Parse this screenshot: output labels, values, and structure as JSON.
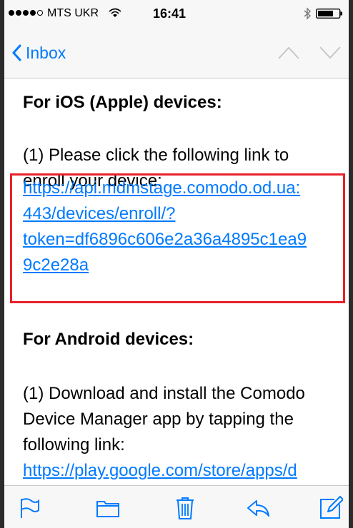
{
  "status_bar": {
    "carrier": "MTS UKR",
    "time": "16:41"
  },
  "nav": {
    "back_label": "Inbox"
  },
  "email": {
    "ios_heading": "For iOS (Apple) devices:",
    "ios_step_line1": "(1) Please click the following link to",
    "ios_step_line2": "enroll your device:",
    "ios_link_lines": [
      "https://api.mdmstage.comodo.od.ua:",
      "443/devices/enroll/?",
      "token=df6896c606e2a36a4895c1ea9",
      "9c2e28a"
    ],
    "android_heading": "For Android devices:",
    "android_step_line1": "(1) Download and install the Comodo",
    "android_step_line2": "Device Manager app by tapping the",
    "android_step_line3": "following link:",
    "android_link_line": "https://play.google.com/store/apps/d"
  },
  "colors": {
    "link": "#007aff",
    "highlight": "#e8202a",
    "bar_bg": "#f7f7f7"
  },
  "icons": {
    "toolbar": [
      "flag-icon",
      "folder-icon",
      "trash-icon",
      "reply-icon",
      "compose-icon"
    ]
  }
}
